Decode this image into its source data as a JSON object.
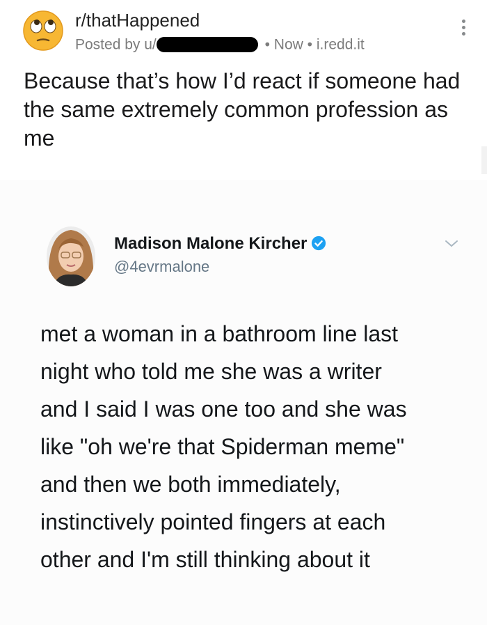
{
  "post": {
    "subreddit": "r/thatHappened",
    "posted_by_prefix": "Posted by u/",
    "meta_separator": "•",
    "time": "Now",
    "domain": "i.redd.it",
    "title": "Because that’s how I’d react if someone had the same extremely common profession as me",
    "subreddit_icon": "rolling-eyes-emoji-icon",
    "menu_icon": "kebab-menu-icon"
  },
  "tweet": {
    "author_name": "Madison Malone Kircher",
    "handle": "@4evrmalone",
    "verified_icon": "verified-badge-icon",
    "lines": [
      "met a woman in a bathroom line last",
      "night who told me she was a writer",
      "and I said I was one too and she was",
      "like \"oh we're that Spiderman meme\"",
      "and then we both immediately,",
      "instinctively pointed fingers at each",
      "other and I'm still thinking about it"
    ]
  },
  "colors": {
    "title_text": "#1a1a1b",
    "meta_text": "#7c7c7c",
    "twitter_verified": "#1da1f2",
    "tweet_text": "#14171a",
    "handle_text": "#657786"
  }
}
